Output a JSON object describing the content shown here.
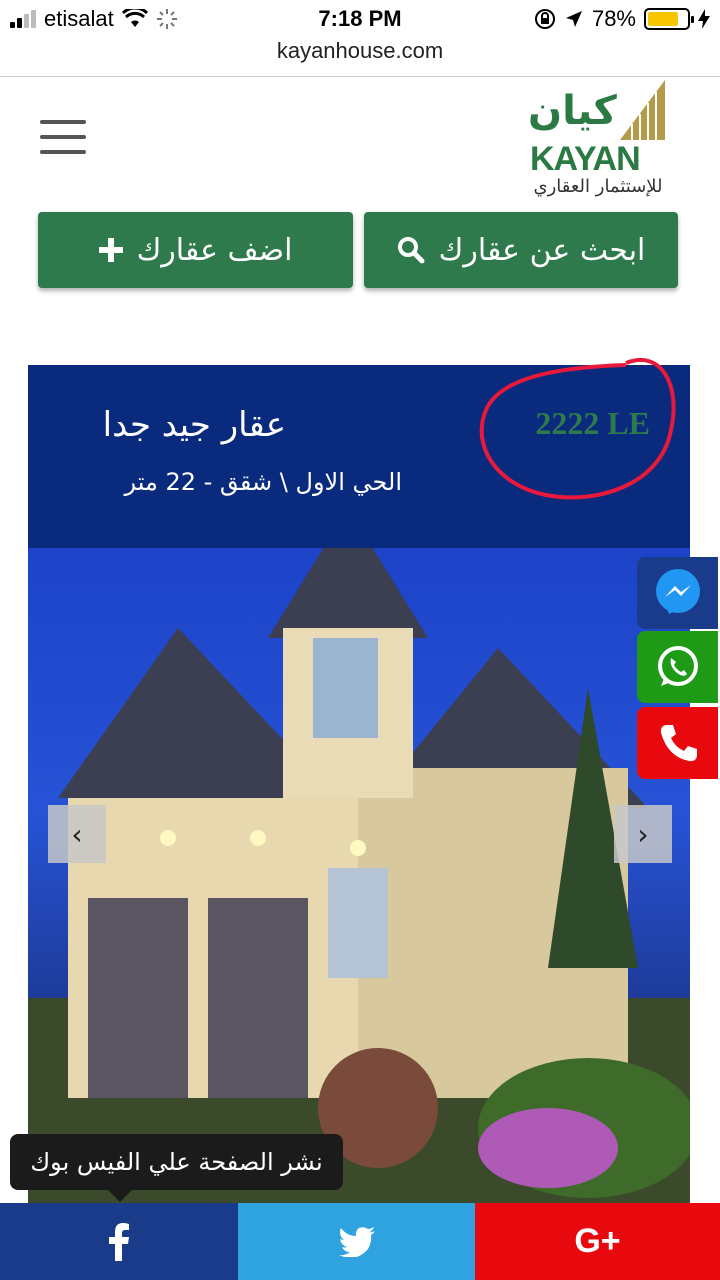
{
  "status_bar": {
    "carrier": "etisalat",
    "time": "7:18 PM",
    "battery": "78%",
    "battery_level": 0.78
  },
  "browser": {
    "url": "kayanhouse.com"
  },
  "logo": {
    "arabic_name": "كيان",
    "brand": "KAYAN",
    "tagline": "للإستثمار العقاري"
  },
  "actions": {
    "search_label": "ابحث عن عقارك",
    "add_label": "اضف عقارك"
  },
  "listing": {
    "title": "عقار جيد جدا",
    "meta": "الحي الاول \\ شقق - 22 متر",
    "price": "2222 LE"
  },
  "contact": {
    "messenger": "messenger-icon",
    "whatsapp": "whatsapp-icon",
    "phone": "phone-icon"
  },
  "share": {
    "tooltip": "نشر الصفحة علي الفيس بوك",
    "google_label": "G+"
  },
  "colors": {
    "green": "#2e7a4c",
    "navy": "#0a2a7e",
    "facebook": "#1a3a8a",
    "twitter": "#2ea3e0",
    "red": "#e8090e",
    "whatsapp": "#1f9a17"
  }
}
